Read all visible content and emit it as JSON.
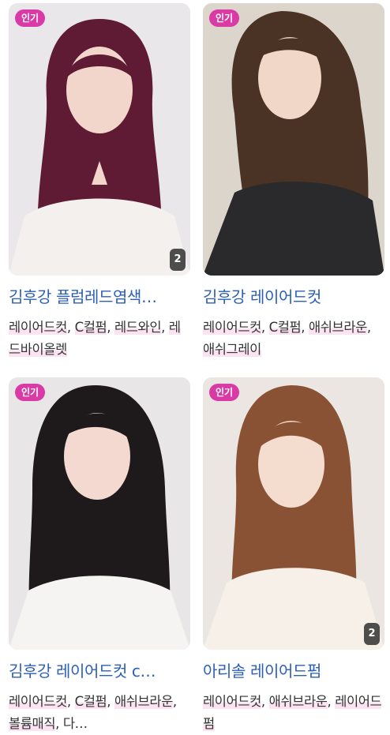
{
  "cards": [
    {
      "badge": "인기",
      "count": "2",
      "title": "김후강 플럼레드염색…",
      "tags": [
        "레이어드컷",
        "C컬펌",
        "레드와인",
        "레드바이올렛"
      ],
      "colors": {
        "background": "#e9e7ea",
        "hair": "#5e1b33",
        "skin": "#f2d6cc",
        "top": "#f4f0ee"
      }
    },
    {
      "badge": "인기",
      "count": "",
      "title": "김후강 레이어드컷",
      "tags": [
        "레이어드컷",
        "C컬펌",
        "애쉬브라운",
        "애쉬그레이"
      ],
      "colors": {
        "background": "#dcd5cb",
        "hair": "#4a3324",
        "skin": "#f0d7c8",
        "top": "#2a2a2d"
      }
    },
    {
      "badge": "인기",
      "count": "",
      "title": "김후강 레이어드컷 c…",
      "tags": [
        "레이어드컷",
        "C컬펌",
        "애쉬브라운",
        "볼륨매직",
        "다…"
      ],
      "colors": {
        "background": "#e8e6e6",
        "hair": "#1e1a1c",
        "skin": "#f3d9cf",
        "top": "#f6f4f3"
      }
    },
    {
      "badge": "인기",
      "count": "2",
      "title": "아리솔 레이어드펌",
      "tags": [
        "레이어드컷",
        "애쉬브라운",
        "레이어드펌"
      ],
      "colors": {
        "background": "#ebe6e1",
        "hair": "#8a5234",
        "skin": "#f4dccf",
        "top": "#f6f0e8"
      }
    }
  ]
}
